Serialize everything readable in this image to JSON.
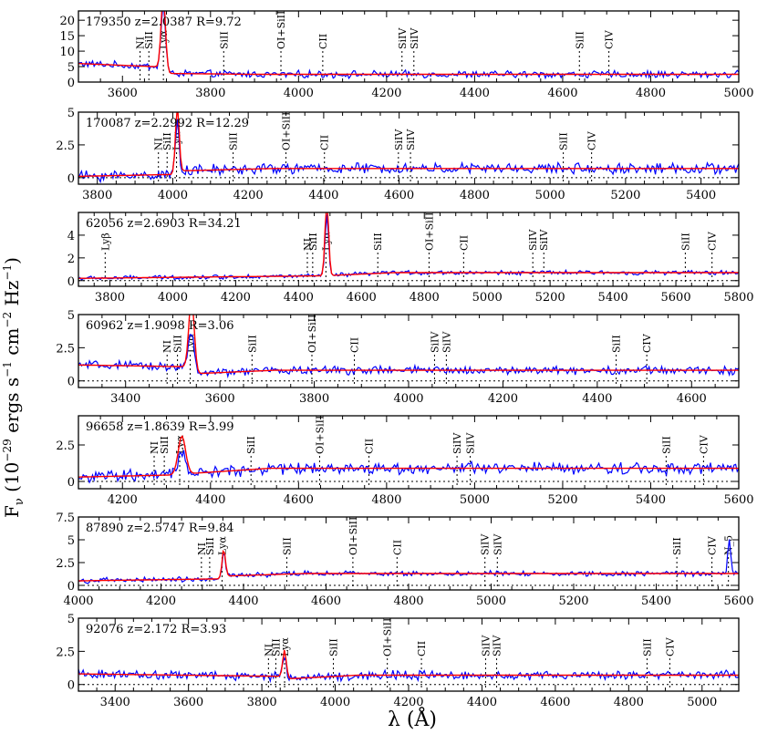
{
  "figure": {
    "ylabel_lines": [
      "F",
      "ν",
      "(10",
      "−29",
      " ergs s",
      "−1",
      " cm",
      "−2",
      " Hz",
      "−1",
      ")"
    ],
    "xlabel": "λ (Å)",
    "colors": {
      "spectrum": "#0000ff",
      "model": "#ff0000",
      "axes": "#000000"
    }
  },
  "chart_data": [
    {
      "type": "line",
      "id": "179350",
      "z_label": "z=2.0387",
      "r_label": "R=9.72",
      "xlim": [
        3500,
        5000
      ],
      "ylim": [
        0,
        23
      ],
      "grid": false,
      "xticks": [
        3600,
        3800,
        4000,
        4200,
        4400,
        4600,
        4800,
        5000
      ],
      "yticks": [
        0,
        5,
        10,
        15,
        20
      ],
      "ytick_labels": [
        "0",
        "5",
        "10",
        "15",
        "20"
      ],
      "continuum": [
        3,
        2.5
      ],
      "blue_continuum": [
        6,
        1.6
      ],
      "noise": 0.9,
      "lines": [
        {
          "label": "NI",
          "x": 3640
        },
        {
          "label": "SiII",
          "x": 3660
        },
        {
          "label": "Lyα",
          "x": 3693
        },
        {
          "label": "SiII",
          "x": 3830
        },
        {
          "label": "OI+SiII",
          "x": 3960
        },
        {
          "label": "CII",
          "x": 4055
        },
        {
          "label": "SiIV",
          "x": 4235
        },
        {
          "label": "SiIV",
          "x": 4262
        },
        {
          "label": "SiII",
          "x": 4638
        },
        {
          "label": "CIV",
          "x": 4705
        }
      ],
      "peaks": [
        {
          "x": 3693,
          "blue": 21,
          "red": 24,
          "width": 7
        }
      ]
    },
    {
      "type": "line",
      "id": "170087",
      "z_label": "z=2.2992",
      "r_label": "R=12.29",
      "xlim": [
        3750,
        5500
      ],
      "ylim": [
        -0.5,
        5
      ],
      "grid": false,
      "xticks": [
        3800,
        4000,
        4200,
        4400,
        4600,
        4800,
        5000,
        5200,
        5400
      ],
      "yticks": [
        0,
        2.5,
        5
      ],
      "ytick_labels": [
        "0",
        "2.5",
        "5"
      ],
      "continuum": [
        0.4,
        0.7
      ],
      "blue_continuum": [
        0.1,
        0.6
      ],
      "noise": 0.32,
      "lines": [
        {
          "label": "NI",
          "x": 3962
        },
        {
          "label": "SiII",
          "x": 3985
        },
        {
          "label": "Lyα",
          "x": 4010
        },
        {
          "label": "SiII",
          "x": 4160
        },
        {
          "label": "OI+SiII",
          "x": 4300
        },
        {
          "label": "CII",
          "x": 4402
        },
        {
          "label": "SiIV",
          "x": 4598
        },
        {
          "label": "SiIV",
          "x": 4630
        },
        {
          "label": "SiII",
          "x": 5035
        },
        {
          "label": "CIV",
          "x": 5110
        }
      ],
      "peaks": [
        {
          "x": 4012,
          "blue": 4.0,
          "red": 5.0,
          "width": 7
        }
      ]
    },
    {
      "type": "line",
      "id": "62056",
      "z_label": "z=2.6903",
      "r_label": "R=34.21",
      "xlim": [
        3700,
        5800
      ],
      "ylim": [
        -0.5,
        6
      ],
      "grid": false,
      "xticks": [
        3800,
        4000,
        4200,
        4400,
        4600,
        4800,
        5000,
        5200,
        5400,
        5600,
        5800
      ],
      "yticks": [
        0,
        2,
        4
      ],
      "ytick_labels": [
        "0",
        "2",
        "4"
      ],
      "continuum": [
        0.25,
        0.7
      ],
      "blue_continuum": [
        0.2,
        0.5
      ],
      "noise": 0.15,
      "lines": [
        {
          "label": "Lyβ",
          "x": 3785
        },
        {
          "label": "NI",
          "x": 4428
        },
        {
          "label": "SiII",
          "x": 4445
        },
        {
          "label": "Lyα",
          "x": 4487
        },
        {
          "label": "SiII",
          "x": 4652
        },
        {
          "label": "OI+SiII",
          "x": 4815
        },
        {
          "label": "CII",
          "x": 4925
        },
        {
          "label": "SiIV",
          "x": 5145
        },
        {
          "label": "SiIV",
          "x": 5180
        },
        {
          "label": "SiII",
          "x": 5630
        },
        {
          "label": "CIV",
          "x": 5715
        }
      ],
      "peaks": [
        {
          "x": 4490,
          "blue": 5.2,
          "red": 6.5,
          "width": 8
        }
      ]
    },
    {
      "type": "line",
      "id": "60962",
      "z_label": "z=1.9098",
      "r_label": "R=3.06",
      "xlim": [
        3300,
        4700
      ],
      "ylim": [
        -0.5,
        5
      ],
      "grid": false,
      "xticks": [
        3400,
        3600,
        3800,
        4000,
        4200,
        4400,
        4600
      ],
      "yticks": [
        0,
        2.5,
        5
      ],
      "ytick_labels": [
        "0",
        "2.5",
        "5"
      ],
      "continuum": [
        0.3,
        0.8
      ],
      "blue_continuum": [
        1.2,
        0.8
      ],
      "noise": 0.25,
      "lines": [
        {
          "label": "NI",
          "x": 3488
        },
        {
          "label": "SiII",
          "x": 3510
        },
        {
          "label": "Lyα",
          "x": 3537
        },
        {
          "label": "SiII",
          "x": 3668
        },
        {
          "label": "OI+SiII",
          "x": 3795
        },
        {
          "label": "CII",
          "x": 3885
        },
        {
          "label": "SiIV",
          "x": 4055
        },
        {
          "label": "SiIV",
          "x": 4080
        },
        {
          "label": "SiII",
          "x": 4440
        },
        {
          "label": "CIV",
          "x": 4505
        }
      ],
      "peaks": [
        {
          "x": 3540,
          "blue": 3.0,
          "red": 5.5,
          "width": 8
        }
      ]
    },
    {
      "type": "line",
      "id": "96658",
      "z_label": "z=1.8639",
      "r_label": "R=3.99",
      "xlim": [
        4100,
        5600
      ],
      "ylim": [
        -0.5,
        4.5
      ],
      "grid": false,
      "xticks": [
        4200,
        4400,
        4600,
        4800,
        5000,
        5200,
        5400,
        5600
      ],
      "yticks": [
        0,
        2.5
      ],
      "ytick_labels": [
        "0",
        "2.5"
      ],
      "continuum": [
        0.2,
        0.9
      ],
      "blue_continuum": [
        0.3,
        0.8
      ],
      "noise": 0.32,
      "lines": [
        {
          "label": "NI",
          "x": 4272
        },
        {
          "label": "SiII",
          "x": 4295
        },
        {
          "label": "Lyα",
          "x": 4330
        },
        {
          "label": "SiII",
          "x": 4492
        },
        {
          "label": "OI+SiII",
          "x": 4648
        },
        {
          "label": "CII",
          "x": 4760
        },
        {
          "label": "SiIV",
          "x": 4960
        },
        {
          "label": "SiIV",
          "x": 4990
        },
        {
          "label": "SiII",
          "x": 5435
        },
        {
          "label": "CIV",
          "x": 5520
        }
      ],
      "peaks": [
        {
          "x": 4335,
          "blue": 1.5,
          "red": 2.6,
          "width": 12
        }
      ]
    },
    {
      "type": "line",
      "id": "87890",
      "z_label": "z=2.5747",
      "r_label": "R=9.84",
      "xlim": [
        4000,
        5600
      ],
      "ylim": [
        -0.5,
        7.5
      ],
      "grid": false,
      "xticks": [
        4000,
        4200,
        4400,
        4600,
        4800,
        5000,
        5200,
        5400,
        5600
      ],
      "yticks": [
        0,
        2.5,
        5,
        7.5
      ],
      "ytick_labels": [
        "0",
        "2.5",
        "5",
        "7.5"
      ],
      "continuum": [
        0.8,
        1.3
      ],
      "blue_continuum": [
        0.5,
        1.0
      ],
      "noise": 0.22,
      "lines": [
        {
          "label": "NI",
          "x": 4298
        },
        {
          "label": "SiII",
          "x": 4318
        },
        {
          "label": "Lyα",
          "x": 4348
        },
        {
          "label": "SiII",
          "x": 4505
        },
        {
          "label": "OI+SiII",
          "x": 4665
        },
        {
          "label": "CII",
          "x": 4772
        },
        {
          "label": "SiIV",
          "x": 4985
        },
        {
          "label": "SiIV",
          "x": 5015
        },
        {
          "label": "SiII",
          "x": 5450
        },
        {
          "label": "CIV",
          "x": 5535
        },
        {
          "label": "N_5",
          "x": 5575
        }
      ],
      "peaks": [
        {
          "x": 4352,
          "blue": 2.6,
          "red": 2.9,
          "width": 6
        },
        {
          "x": 5577,
          "blue": 3.8,
          "red": 0,
          "width": 5
        }
      ]
    },
    {
      "type": "line",
      "id": "92076",
      "z_label": "z=2.172",
      "r_label": "R=3.93",
      "xlim": [
        3300,
        5100
      ],
      "ylim": [
        -0.5,
        5
      ],
      "grid": false,
      "xticks": [
        3400,
        3600,
        3800,
        4000,
        4200,
        4400,
        4600,
        4800,
        5000
      ],
      "yticks": [
        0,
        2.5,
        5
      ],
      "ytick_labels": [
        "0",
        "2.5",
        "5"
      ],
      "continuum": [
        0.2,
        0.7
      ],
      "blue_continuum": [
        0.8,
        0.5
      ],
      "noise": 0.26,
      "lines": [
        {
          "label": "NI",
          "x": 3818
        },
        {
          "label": "SiII",
          "x": 3838
        },
        {
          "label": "Lyα",
          "x": 3862
        },
        {
          "label": "SiII",
          "x": 3995
        },
        {
          "label": "OI+SiII",
          "x": 4142
        },
        {
          "label": "CII",
          "x": 4235
        },
        {
          "label": "SiIV",
          "x": 4410
        },
        {
          "label": "SiIV",
          "x": 4440
        },
        {
          "label": "SiII",
          "x": 4850
        },
        {
          "label": "CIV",
          "x": 4912
        }
      ],
      "peaks": [
        {
          "x": 3862,
          "blue": 1.6,
          "red": 2.0,
          "width": 7
        }
      ]
    }
  ]
}
